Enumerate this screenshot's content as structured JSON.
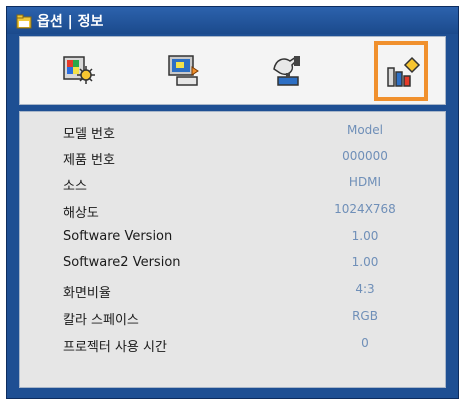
{
  "title": "옵션 | 정보",
  "tabs": [
    {
      "icon": "image-settings-icon",
      "active": false
    },
    {
      "icon": "display-settings-icon",
      "active": false
    },
    {
      "icon": "setup-icon",
      "active": false
    },
    {
      "icon": "options-icon",
      "active": true
    }
  ],
  "info_rows": [
    {
      "label": "모델 번호",
      "value": "Model"
    },
    {
      "label": "제품 번호",
      "value": "000000"
    },
    {
      "label": "소스",
      "value": "HDMI"
    },
    {
      "label": "해상도",
      "value": "1024X768"
    },
    {
      "label": "Software Version",
      "value": "1.00"
    },
    {
      "label": "Software2 Version",
      "value": "1.00"
    },
    {
      "label": "화면비율",
      "value": "4:3"
    },
    {
      "label": "칼라 스페이스",
      "value": "RGB"
    },
    {
      "label": "프로젝터 사용 시간",
      "value": "0"
    }
  ],
  "colors": {
    "frame": "#1e4f93",
    "accent": "#f0902d",
    "value_text": "#6f8fb8"
  }
}
